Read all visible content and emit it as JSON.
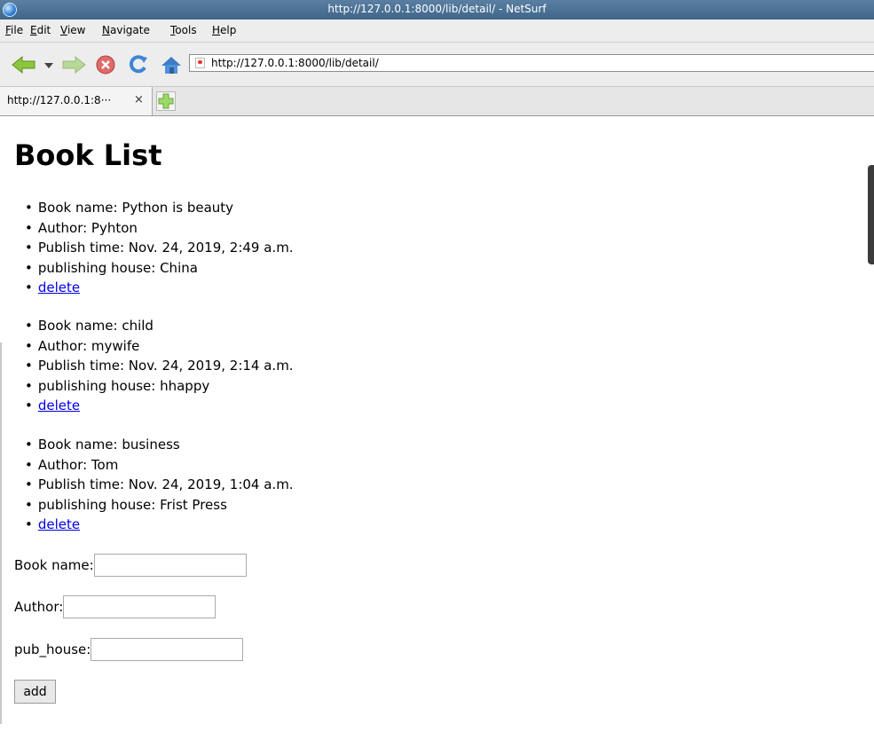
{
  "window": {
    "title": "http://127.0.0.1:8000/lib/detail/ - NetSurf"
  },
  "menu": [
    {
      "label": "File",
      "ul": "F",
      "rest": "ile"
    },
    {
      "label": "Edit",
      "ul": "E",
      "rest": "dit"
    },
    {
      "label": "View",
      "ul": "V",
      "rest": "iew"
    },
    {
      "label": "Navigate",
      "ul": "N",
      "rest": "avigate"
    },
    {
      "label": "Tools",
      "ul": "T",
      "rest": "ools"
    },
    {
      "label": "Help",
      "ul": "H",
      "rest": "elp"
    }
  ],
  "toolbar": {
    "url": "http://127.0.0.1:8000/lib/detail/"
  },
  "tab": {
    "title": "http://127.0.0.1:8···",
    "close": "×"
  },
  "page": {
    "heading": "Book List",
    "books": [
      {
        "name": "Book name: Python is beauty",
        "author": "Author: Pyhton",
        "time": "Publish time: Nov. 24, 2019, 2:49 a.m.",
        "house": "publishing house: China",
        "delete": "delete"
      },
      {
        "name": "Book name: child",
        "author": "Author: mywife",
        "time": "Publish time: Nov. 24, 2019, 2:14 a.m.",
        "house": "publishing house: hhappy",
        "delete": "delete"
      },
      {
        "name": "Book name: business",
        "author": "Author: Tom",
        "time": "Publish time: Nov. 24, 2019, 1:04 a.m.",
        "house": "publishing house: Frist Press",
        "delete": "delete"
      }
    ],
    "form": {
      "book_name_label": "Book name:",
      "author_label": "Author:",
      "pub_house_label": "pub_house:",
      "book_name_value": "",
      "author_value": "",
      "pub_house_value": "",
      "add_label": "add"
    }
  }
}
